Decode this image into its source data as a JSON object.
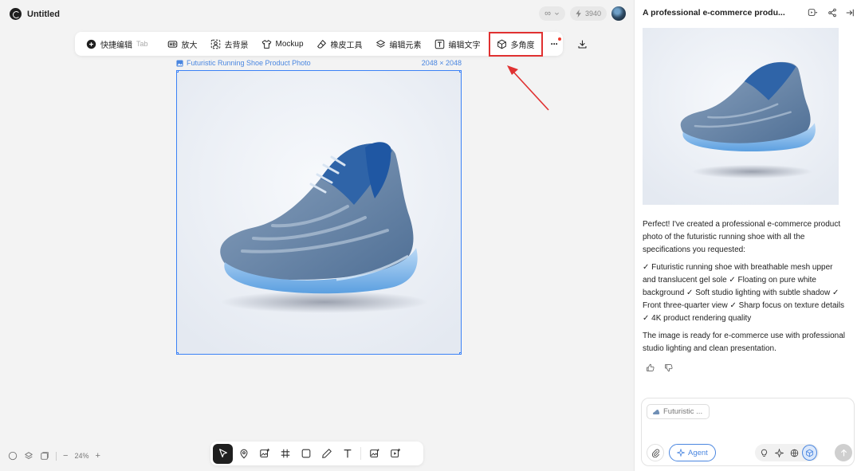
{
  "app": {
    "title": "Untitled"
  },
  "topbar": {
    "infinity_label": "∞",
    "credits": "3940"
  },
  "toolbar": {
    "items": [
      {
        "label": "快捷编辑",
        "kbd": "Tab"
      },
      {
        "label": "放大"
      },
      {
        "label": "去背景"
      },
      {
        "label": "Mockup"
      },
      {
        "label": "橡皮工具"
      },
      {
        "label": "编辑元素"
      },
      {
        "label": "编辑文字"
      },
      {
        "label": "多角度"
      }
    ],
    "more_label": "···"
  },
  "image": {
    "name": "Futuristic Running Shoe Product Photo",
    "size": "2048 × 2048"
  },
  "zoom": {
    "level": "24%",
    "minus": "−",
    "plus": "+"
  },
  "panel": {
    "title": "A professional e-commerce produ...",
    "message": {
      "p1": "Perfect! I've created a professional e-commerce product photo of the futuristic running shoe with all the specifications you requested:",
      "p2": "✓ Futuristic running shoe with breathable mesh upper and translucent gel sole ✓ Floating on pure white background ✓ Soft studio lighting with subtle shadow ✓ Front three-quarter view ✓ Sharp focus on texture details ✓ 4K product rendering quality",
      "p3": "The image is ready for e-commerce use with professional studio lighting and clean presentation."
    },
    "composer": {
      "chip": "Futuristic ...",
      "agent_label": "Agent"
    }
  },
  "colors": {
    "accent": "#4a86e0",
    "highlight": "#e03131",
    "selection": "#3b82f6"
  }
}
